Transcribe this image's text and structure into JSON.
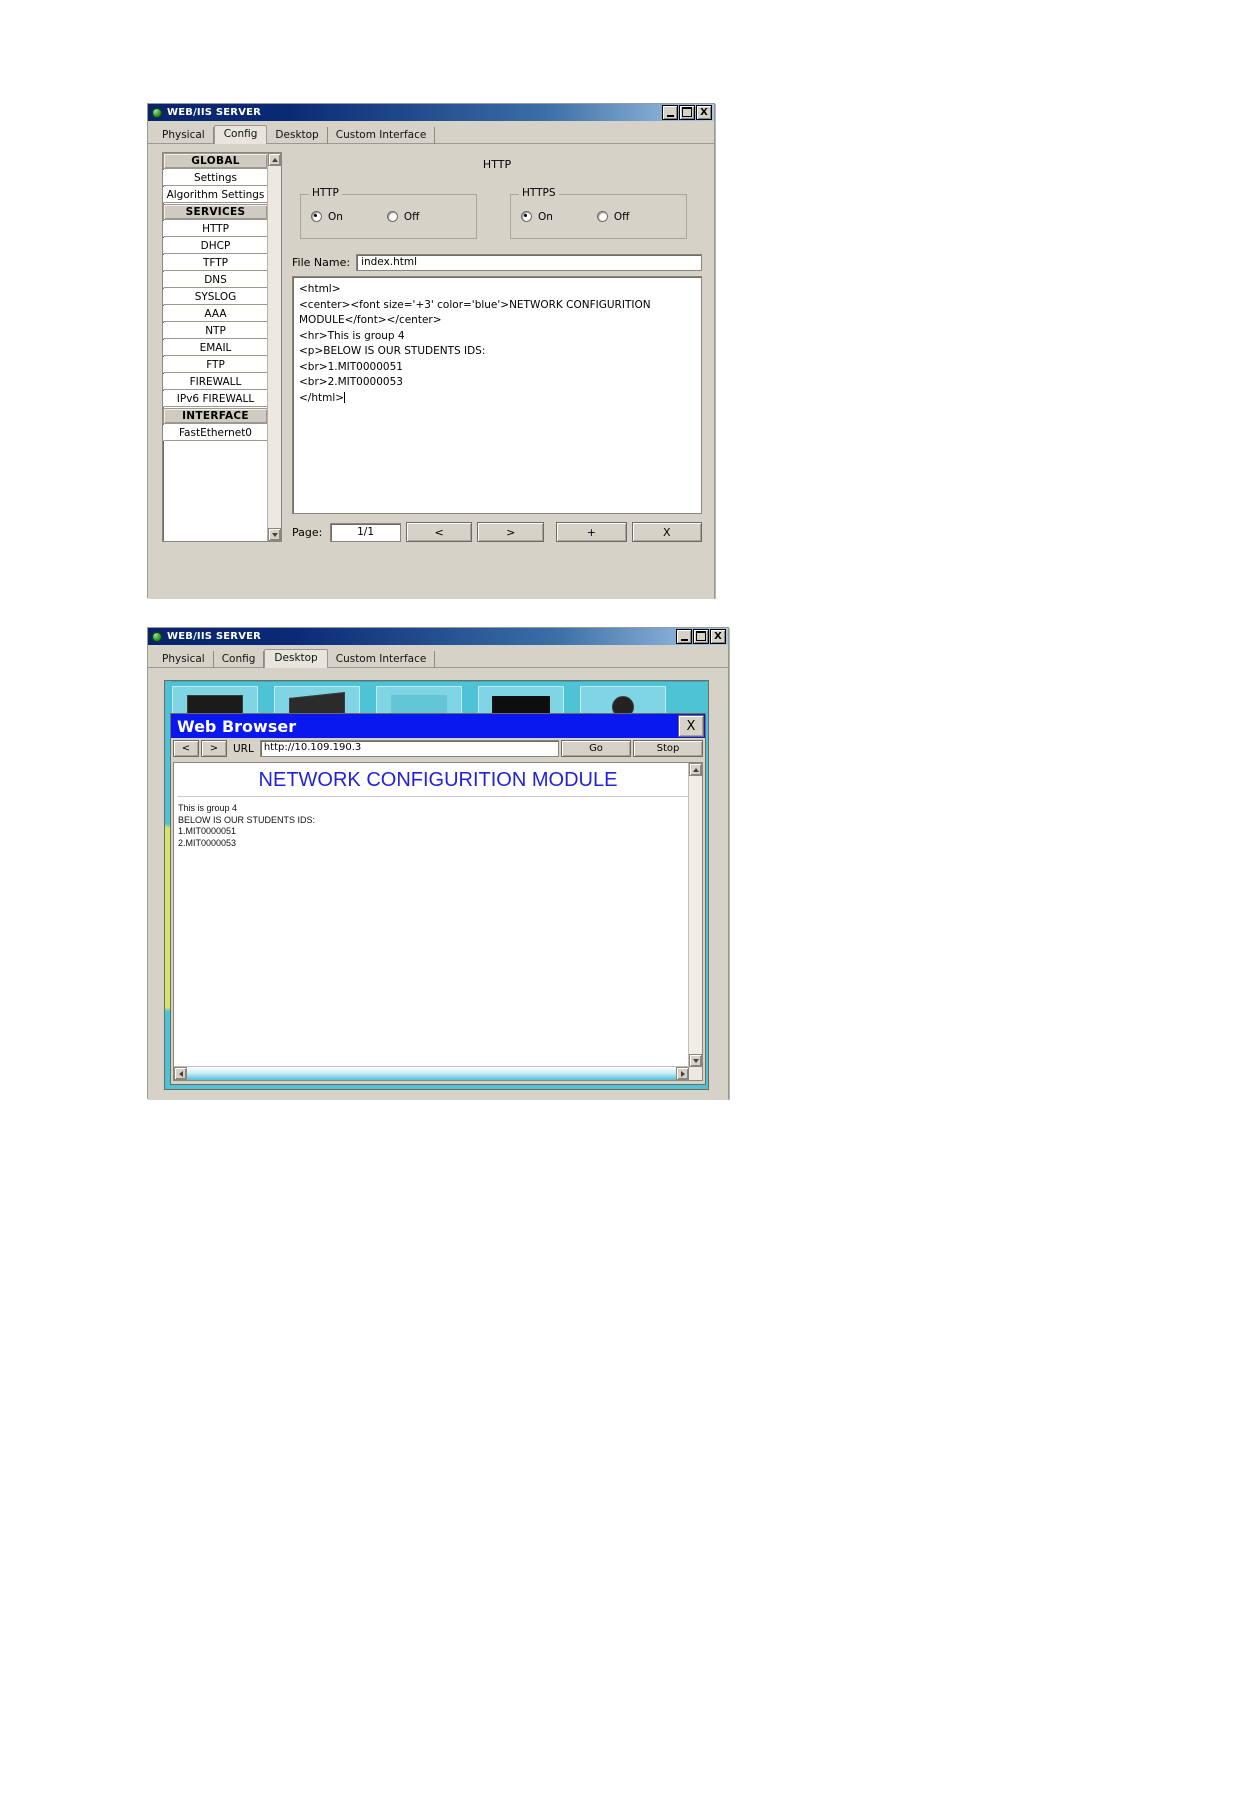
{
  "window_config": {
    "title": "WEB/IIS SERVER",
    "controls": {
      "minimize": "_",
      "maximize": "□",
      "close": "X"
    },
    "tabs": [
      {
        "label": "Physical",
        "active": false
      },
      {
        "label": "Config",
        "active": true
      },
      {
        "label": "Desktop",
        "active": false
      },
      {
        "label": "Custom Interface",
        "active": false
      }
    ],
    "nav_items": [
      {
        "label": "GLOBAL",
        "type": "header"
      },
      {
        "label": "Settings",
        "type": "item"
      },
      {
        "label": "Algorithm Settings",
        "type": "item"
      },
      {
        "label": "SERVICES",
        "type": "header"
      },
      {
        "label": "HTTP",
        "type": "item"
      },
      {
        "label": "DHCP",
        "type": "item"
      },
      {
        "label": "TFTP",
        "type": "item"
      },
      {
        "label": "DNS",
        "type": "item"
      },
      {
        "label": "SYSLOG",
        "type": "item"
      },
      {
        "label": "AAA",
        "type": "item"
      },
      {
        "label": "NTP",
        "type": "item"
      },
      {
        "label": "EMAIL",
        "type": "item"
      },
      {
        "label": "FTP",
        "type": "item"
      },
      {
        "label": "FIREWALL",
        "type": "item"
      },
      {
        "label": "IPv6 FIREWALL",
        "type": "item"
      },
      {
        "label": "INTERFACE",
        "type": "header"
      },
      {
        "label": "FastEthernet0",
        "type": "item"
      }
    ],
    "panel_title": "HTTP",
    "http_group": {
      "legend": "HTTP",
      "on_label": "On",
      "off_label": "Off",
      "selected": "On"
    },
    "https_group": {
      "legend": "HTTPS",
      "on_label": "On",
      "off_label": "Off",
      "selected": "On"
    },
    "file_name_label": "File Name:",
    "file_name_value": "index.html",
    "code_content": "<html>\n<center><font size='+3' color='blue'>NETWORK CONFIGURITION MODULE</font></center>\n<hr>This is group 4\n<p>BELOW IS OUR STUDENTS IDS:\n<br>1.MIT0000051\n<br>2.MIT0000053\n</html>",
    "page_label": "Page:",
    "page_value": "1/1",
    "buttons": {
      "prev": "<",
      "next": ">",
      "add": "+",
      "delete": "X"
    }
  },
  "window_desktop": {
    "title": "WEB/IIS SERVER",
    "controls": {
      "minimize": "_",
      "maximize": "□",
      "close": "X"
    },
    "tabs": [
      {
        "label": "Physical",
        "active": false
      },
      {
        "label": "Config",
        "active": false
      },
      {
        "label": "Desktop",
        "active": true
      },
      {
        "label": "Custom Interface",
        "active": false
      }
    ],
    "browser": {
      "title": "Web Browser",
      "close_label": "X",
      "back_label": "<",
      "forward_label": ">",
      "url_label": "URL",
      "url_value": "http://10.109.190.3",
      "go_label": "Go",
      "stop_label": "Stop",
      "rendered": {
        "heading": "NETWORK CONFIGURITION MODULE",
        "heading_color": "#2222dd",
        "lines": [
          "This is group 4",
          "BELOW IS OUR STUDENTS IDS:",
          "1.MIT0000051",
          "2.MIT0000053"
        ]
      }
    }
  },
  "colors": {
    "window_face": "#d6d2c8",
    "titlebar_start": "#0a246a",
    "browser_title": "#0a18f0",
    "desktop_bg": "#4ec3d6",
    "heading_blue": "#2222dd"
  }
}
